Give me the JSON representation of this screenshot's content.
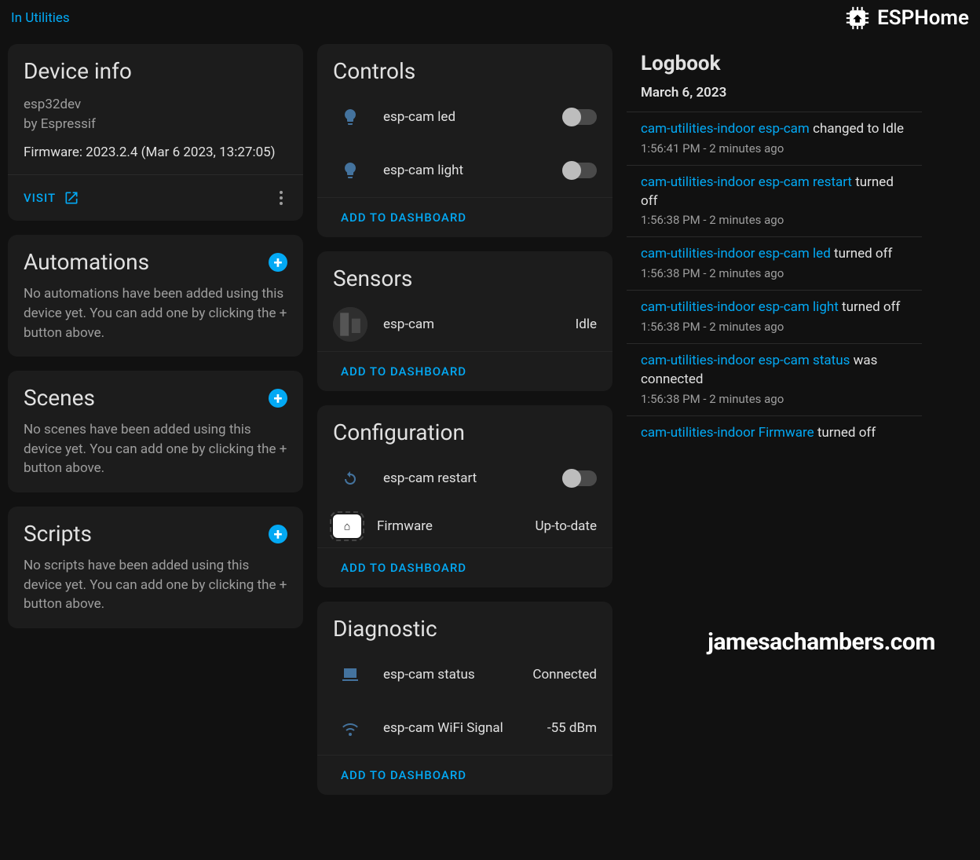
{
  "topbar": {
    "breadcrumb": "In Utilities",
    "brand": "ESPHome"
  },
  "deviceInfo": {
    "title": "Device info",
    "model": "esp32dev",
    "manufacturer": "by Espressif",
    "firmware": "Firmware: 2023.2.4 (Mar 6 2023, 13:27:05)",
    "visit": "VISIT"
  },
  "automations": {
    "title": "Automations",
    "empty": "No automations have been added using this device yet. You can add one by clicking the + button above."
  },
  "scenes": {
    "title": "Scenes",
    "empty": "No scenes have been added using this device yet. You can add one by clicking the + button above."
  },
  "scripts": {
    "title": "Scripts",
    "empty": "No scripts have been added using this device yet. You can add one by clicking the + button above."
  },
  "controls": {
    "title": "Controls",
    "rows": [
      {
        "name": "esp-cam led"
      },
      {
        "name": "esp-cam light"
      }
    ],
    "add": "ADD TO DASHBOARD"
  },
  "sensors": {
    "title": "Sensors",
    "rows": [
      {
        "name": "esp-cam",
        "state": "Idle"
      }
    ],
    "add": "ADD TO DASHBOARD"
  },
  "configuration": {
    "title": "Configuration",
    "restart": "esp-cam restart",
    "firmware_label": "Firmware",
    "firmware_state": "Up-to-date",
    "add": "ADD TO DASHBOARD"
  },
  "diagnostic": {
    "title": "Diagnostic",
    "rows": [
      {
        "name": "esp-cam status",
        "state": "Connected"
      },
      {
        "name": "esp-cam WiFi Signal",
        "state": "-55 dBm"
      }
    ],
    "add": "ADD TO DASHBOARD"
  },
  "logbook": {
    "title": "Logbook",
    "date": "March 6, 2023",
    "entries": [
      {
        "entity": "cam-utilities-indoor esp-cam",
        "action": "changed to Idle",
        "time": "1:56:41 PM - 2 minutes ago"
      },
      {
        "entity": "cam-utilities-indoor esp-cam restart",
        "action": "turned off",
        "time": "1:56:38 PM - 2 minutes ago"
      },
      {
        "entity": "cam-utilities-indoor esp-cam led",
        "action": "turned off",
        "time": "1:56:38 PM - 2 minutes ago"
      },
      {
        "entity": "cam-utilities-indoor esp-cam light",
        "action": "turned off",
        "time": "1:56:38 PM - 2 minutes ago"
      },
      {
        "entity": "cam-utilities-indoor esp-cam status",
        "action": "was connected",
        "time": "1:56:38 PM - 2 minutes ago"
      },
      {
        "entity": "cam-utilities-indoor Firmware",
        "action": "turned off",
        "time": ""
      }
    ]
  },
  "watermark": "jamesachambers.com"
}
